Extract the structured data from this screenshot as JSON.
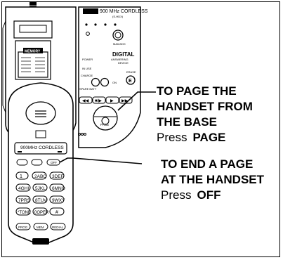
{
  "base": {
    "model": "900 MHz CORDLESS",
    "model_sub": "(S-HDX)",
    "mailbox_label": "MAILBOX",
    "digital_title": "DIGITAL",
    "digital_sub1": "ANSWERING",
    "digital_sub2": "DEVICE",
    "power_label": "POWER",
    "in_use_label": "IN USE",
    "charge_label": "CHARGE",
    "spare_batt_label": "SPARE BATT",
    "on_label": "ON",
    "erase_label": "ERASE",
    "page_button_label": "PAGE",
    "memory_label": "MEMORY"
  },
  "handset": {
    "brand_label": "900MHz CORDLESS",
    "off_key": "OFF",
    "keypad": [
      "1",
      "2ABC",
      "3DEF",
      "4GHI",
      "5JKL",
      "6MNO",
      "7PRS",
      "8TUV",
      "9WXY",
      "*TONE",
      "0OPER",
      "#"
    ],
    "bottom_keys": [
      "PROG",
      "MEM",
      "REDIAL"
    ]
  },
  "callouts": {
    "page": {
      "heading": [
        "TO PAGE THE",
        "HANDSET FROM",
        "THE BASE"
      ],
      "press": "Press",
      "key": "PAGE"
    },
    "end": {
      "heading": [
        "TO END A PAGE",
        "AT THE HANDSET"
      ],
      "press": "Press",
      "key": "OFF"
    }
  }
}
